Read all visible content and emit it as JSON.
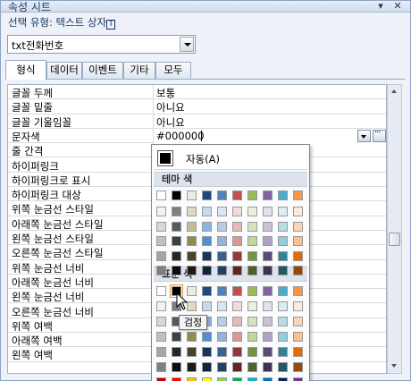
{
  "window": {
    "title": "속성 시트",
    "pin_icon": "pin-icon",
    "close_icon": "close-icon"
  },
  "selection_type": {
    "label": "선택 유형: 텍스트 상자",
    "hotkey": "T"
  },
  "control_combo": {
    "value": "txt전화번호"
  },
  "tabs": [
    {
      "label": "형식",
      "active": true
    },
    {
      "label": "데이터",
      "active": false
    },
    {
      "label": "이벤트",
      "active": false
    },
    {
      "label": "기타",
      "active": false
    },
    {
      "label": "모두",
      "active": false
    }
  ],
  "properties": [
    {
      "label": "글꼴 두께",
      "value": "보통"
    },
    {
      "label": "글꼴 밑줄",
      "value": "아니요"
    },
    {
      "label": "글꼴 기울임꼴",
      "value": "아니요"
    },
    {
      "label": "문자색",
      "value": "#000000",
      "active": true
    },
    {
      "label": "줄 간격",
      "value": ""
    },
    {
      "label": "하이퍼링크",
      "value": ""
    },
    {
      "label": "하이퍼링크로 표시",
      "value": ""
    },
    {
      "label": "하이퍼링크 대상",
      "value": ""
    },
    {
      "label": "위쪽 눈금선 스타일",
      "value": ""
    },
    {
      "label": "아래쪽 눈금선 스타일",
      "value": ""
    },
    {
      "label": "왼쪽 눈금선 스타일",
      "value": ""
    },
    {
      "label": "오른쪽 눈금선 스타일",
      "value": ""
    },
    {
      "label": "위쪽 눈금선 너비",
      "value": ""
    },
    {
      "label": "아래쪽 눈금선 너비",
      "value": ""
    },
    {
      "label": "왼쪽 눈금선 너비",
      "value": ""
    },
    {
      "label": "오른쪽 눈금선 너비",
      "value": ""
    },
    {
      "label": "위쪽 여백",
      "value": ""
    },
    {
      "label": "아래쪽 여백",
      "value": ""
    },
    {
      "label": "왼쪽 여백",
      "value": ""
    }
  ],
  "color_picker": {
    "automatic_label": "자동(A)",
    "theme_header": "테마 색",
    "standard_header": "표준 색",
    "tooltip": "검정",
    "theme_top": [
      "#ffffff",
      "#000000",
      "#eeece1",
      "#1f497d",
      "#4f81bd",
      "#c0504d",
      "#9bbb59",
      "#8064a2",
      "#4bacc6",
      "#f79646"
    ],
    "theme_shades": [
      [
        "#f2f2f2",
        "#7f7f7f",
        "#ddd9c3",
        "#c6d9f0",
        "#dbe5f1",
        "#f2dcdb",
        "#ebf1dd",
        "#e5e0ec",
        "#dbeef3",
        "#fdeada"
      ],
      [
        "#d8d8d8",
        "#595959",
        "#c4bd97",
        "#8db3e2",
        "#b8cce4",
        "#e5b9b7",
        "#d7e3bc",
        "#ccc1d9",
        "#b7dde8",
        "#fbd5b5"
      ],
      [
        "#bfbfbf",
        "#3f3f3f",
        "#938953",
        "#548dd4",
        "#95b3d7",
        "#d99694",
        "#c3d69b",
        "#b2a2c7",
        "#92cddc",
        "#fac08f"
      ],
      [
        "#a5a5a5",
        "#262626",
        "#494429",
        "#17365d",
        "#366092",
        "#953734",
        "#76923c",
        "#5f497a",
        "#31859b",
        "#e36c09"
      ],
      [
        "#7f7f7f",
        "#0c0c0c",
        "#1d1b10",
        "#0f243e",
        "#244061",
        "#632423",
        "#4f6128",
        "#3f3151",
        "#205867",
        "#974806"
      ]
    ],
    "standard_top": [
      "#ffffff",
      "#000000",
      "#eeece1",
      "#1f497d",
      "#4f81bd",
      "#c0504d",
      "#9bbb59",
      "#8064a2",
      "#4bacc6",
      "#f79646"
    ],
    "standard_rows": [
      [
        "#f2f2f2",
        "#7f7f7f",
        "#ddd9c3",
        "#c6d9f0",
        "#dbe5f1",
        "#f2dcdb",
        "#ebf1dd",
        "#e5e0ec",
        "#dbeef3",
        "#fdeada"
      ],
      [
        "#d8d8d8",
        "#595959",
        "#c4bd97",
        "#8db3e2",
        "#b8cce4",
        "#e5b9b7",
        "#d7e3bc",
        "#ccc1d9",
        "#b7dde8",
        "#fbd5b5"
      ],
      [
        "#bfbfbf",
        "#3f3f3f",
        "#938953",
        "#548dd4",
        "#95b3d7",
        "#d99694",
        "#c3d69b",
        "#b2a2c7",
        "#92cddc",
        "#fac08f"
      ],
      [
        "#a5a5a5",
        "#262626",
        "#494429",
        "#17365d",
        "#366092",
        "#953734",
        "#76923c",
        "#5f497a",
        "#31859b",
        "#e36c09"
      ],
      [
        "#7f7f7f",
        "#0c0c0c",
        "#1d1b10",
        "#0f243e",
        "#244061",
        "#632423",
        "#4f6128",
        "#3f3151",
        "#205867",
        "#974806"
      ],
      [
        "#c00000",
        "#ff0000",
        "#ffc000",
        "#ffff00",
        "#92d050",
        "#00b050",
        "#00b0f0",
        "#0070c0",
        "#002060",
        "#7030a0"
      ]
    ]
  }
}
